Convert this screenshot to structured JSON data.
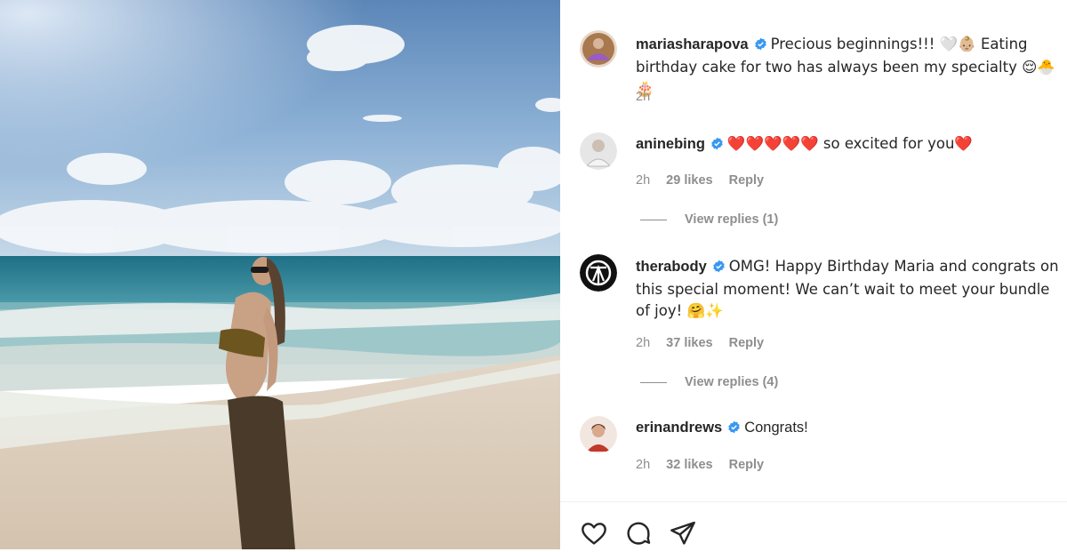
{
  "post": {
    "username": "mariasharapova",
    "caption": "Precious beginnings!!! 🤍👶🏼 Eating birthday cake for two has always been my specialty 😌🐣🎂",
    "time": "2h"
  },
  "comments": [
    {
      "username": "aninebing",
      "text": "❤️❤️❤️❤️❤️ so excited for you❤️",
      "time": "2h",
      "likes": "29 likes",
      "reply": "Reply",
      "view_replies": "View replies (1)"
    },
    {
      "username": "therabody",
      "text": "OMG! Happy Birthday Maria and congrats on this special moment! We can’t wait to meet your bundle of joy! 🤗✨",
      "time": "2h",
      "likes": "37 likes",
      "reply": "Reply",
      "view_replies": "View replies (4)"
    },
    {
      "username": "erinandrews",
      "text": "Congrats!",
      "time": "2h",
      "likes": "32 likes",
      "reply": "Reply"
    }
  ],
  "icons": {
    "verified": "verified-badge-icon",
    "like": "heart-icon",
    "comment": "comment-bubble-icon",
    "share": "paper-plane-icon"
  },
  "colors": {
    "verified": "#3897f0",
    "text": "#262626",
    "muted": "#8e8e8e",
    "heart": "#ed4956"
  }
}
